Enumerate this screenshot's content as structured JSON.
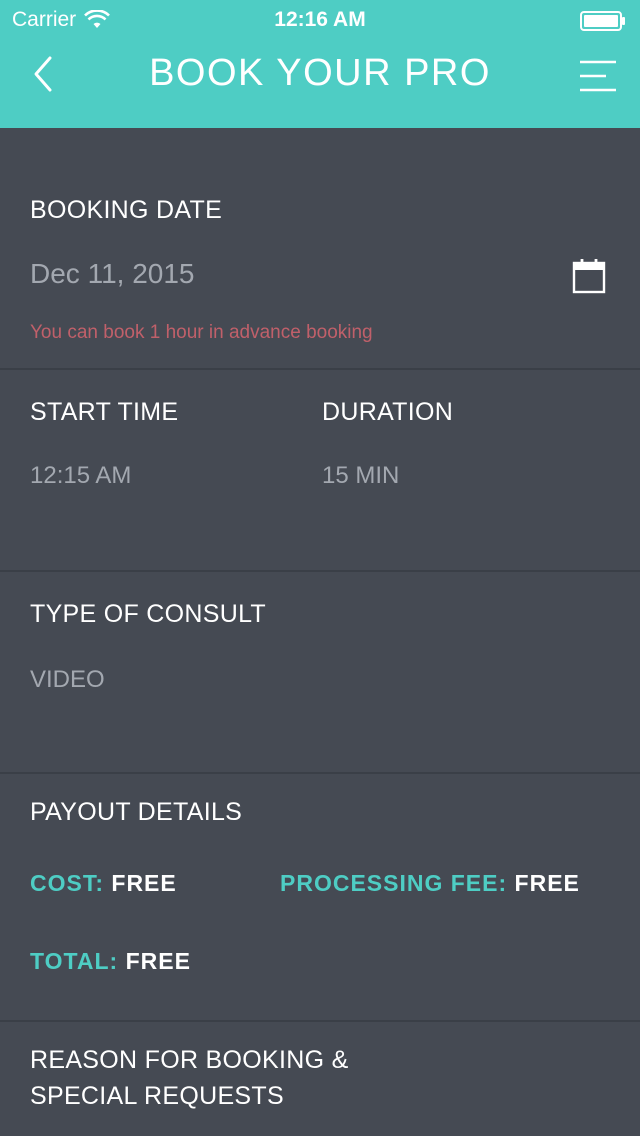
{
  "status_bar": {
    "carrier": "Carrier",
    "time": "12:16 AM"
  },
  "nav": {
    "title": "BOOK YOUR PRO"
  },
  "booking_date": {
    "label": "BOOKING DATE",
    "value": "Dec 11, 2015",
    "note": "You can book 1 hour in advance booking"
  },
  "start_time": {
    "label": "START TIME",
    "value": "12:15 AM"
  },
  "duration": {
    "label": "DURATION",
    "value": "15 MIN"
  },
  "consult": {
    "label": "TYPE OF CONSULT",
    "value": "VIDEO"
  },
  "payout": {
    "label": "PAYOUT DETAILS",
    "cost_label": "COST:",
    "cost_value": "FREE",
    "fee_label": "PROCESSING FEE:",
    "fee_value": "FREE",
    "total_label": "TOTAL:",
    "total_value": "FREE"
  },
  "reason": {
    "label_line1": "REASON FOR BOOKING &",
    "label_line2": "SPECIAL REQUESTS"
  },
  "icons": {
    "back": "chevron-left-icon",
    "menu": "menu-icon",
    "calendar": "calendar-icon",
    "wifi": "wifi-icon",
    "battery": "battery-icon"
  },
  "colors": {
    "accent": "#4ecdc4",
    "background": "#454a53",
    "note": "#c0606a"
  }
}
